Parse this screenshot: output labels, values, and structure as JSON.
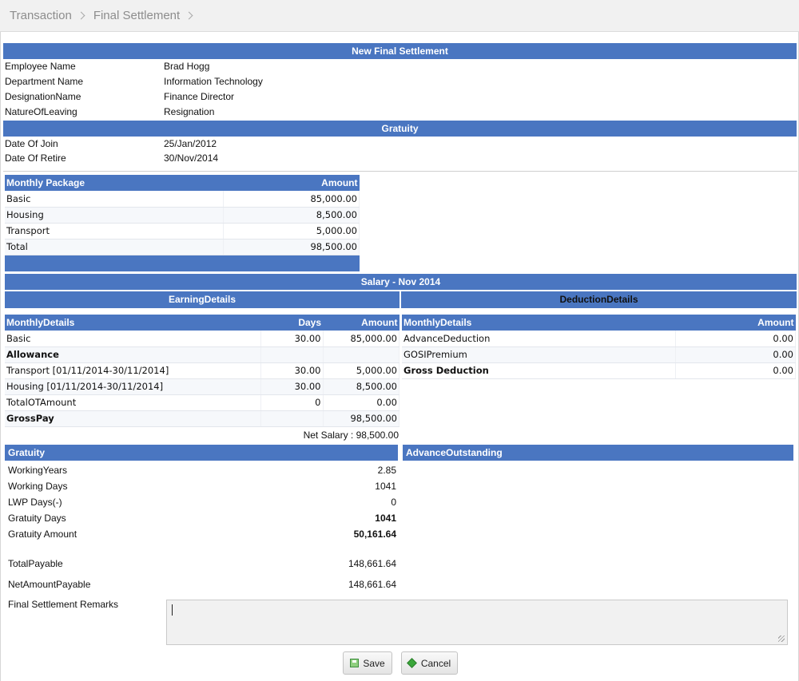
{
  "breadcrumb": [
    "Transaction",
    "Final Settlement"
  ],
  "header_title": "New Final Settlement",
  "employee": [
    {
      "label": "Employee Name",
      "value": "Brad Hogg"
    },
    {
      "label": "Department Name",
      "value": "Information Technology"
    },
    {
      "label": "DesignationName",
      "value": "Finance Director"
    },
    {
      "label": "NatureOfLeaving",
      "value": "Resignation"
    }
  ],
  "gratuity_title": "Gratuity",
  "dates": [
    {
      "label": "Date Of Join",
      "value": "25/Jan/2012"
    },
    {
      "label": "Date Of Retire",
      "value": "30/Nov/2014"
    }
  ],
  "package": {
    "headers": [
      "Monthly Package",
      "Amount"
    ],
    "rows": [
      {
        "name": "Basic",
        "amount": "85,000.00"
      },
      {
        "name": "Housing",
        "amount": "8,500.00"
      },
      {
        "name": "Transport",
        "amount": "5,000.00"
      },
      {
        "name": "Total",
        "amount": "98,500.00"
      }
    ]
  },
  "salary_title": "Salary - Nov 2014",
  "earning_title": "EarningDetails",
  "deduction_title": "DeductionDetails",
  "earnings": {
    "headers": [
      "MonthlyDetails",
      "Days",
      "Amount"
    ],
    "rows": [
      {
        "name": "Basic",
        "days": "30.00",
        "amount": "85,000.00",
        "bold": false
      },
      {
        "name": "Allowance",
        "days": "",
        "amount": "",
        "bold": true
      },
      {
        "name": "Transport [01/11/2014-30/11/2014]",
        "days": "30.00",
        "amount": "5,000.00",
        "bold": false
      },
      {
        "name": "Housing [01/11/2014-30/11/2014]",
        "days": "30.00",
        "amount": "8,500.00",
        "bold": false
      },
      {
        "name": "TotalOTAmount",
        "days": "0",
        "amount": "0.00",
        "bold": false
      },
      {
        "name": "GrossPay",
        "days": "",
        "amount": "98,500.00",
        "bold": true
      }
    ]
  },
  "deductions": {
    "headers": [
      "MonthlyDetails",
      "Amount"
    ],
    "rows": [
      {
        "name": "AdvanceDeduction",
        "amount": "0.00",
        "bold": false
      },
      {
        "name": "GOSIPremium",
        "amount": "0.00",
        "bold": false
      },
      {
        "name": "Gross Deduction",
        "amount": "0.00",
        "bold": true
      }
    ]
  },
  "net_salary": "Net Salary : 98,500.00",
  "gratuity_section": {
    "title": "Gratuity",
    "rows": [
      {
        "label": "WorkingYears",
        "value": "2.85",
        "bold": false
      },
      {
        "label": "Working Days",
        "value": "1041",
        "bold": false
      },
      {
        "label": "LWP Days(-)",
        "value": "0",
        "bold": false
      },
      {
        "label": "Gratuity Days",
        "value": "1041",
        "bold": true
      },
      {
        "label": "Gratuity Amount",
        "value": "50,161.64",
        "bold": true
      }
    ]
  },
  "advance_title": "AdvanceOutstanding",
  "total_payable": {
    "label": "TotalPayable",
    "value": "148,661.64"
  },
  "net_payable": {
    "label": "NetAmountPayable",
    "value": "148,661.64"
  },
  "remarks_label": "Final Settlement Remarks",
  "save_label": "Save",
  "cancel_label": "Cancel"
}
